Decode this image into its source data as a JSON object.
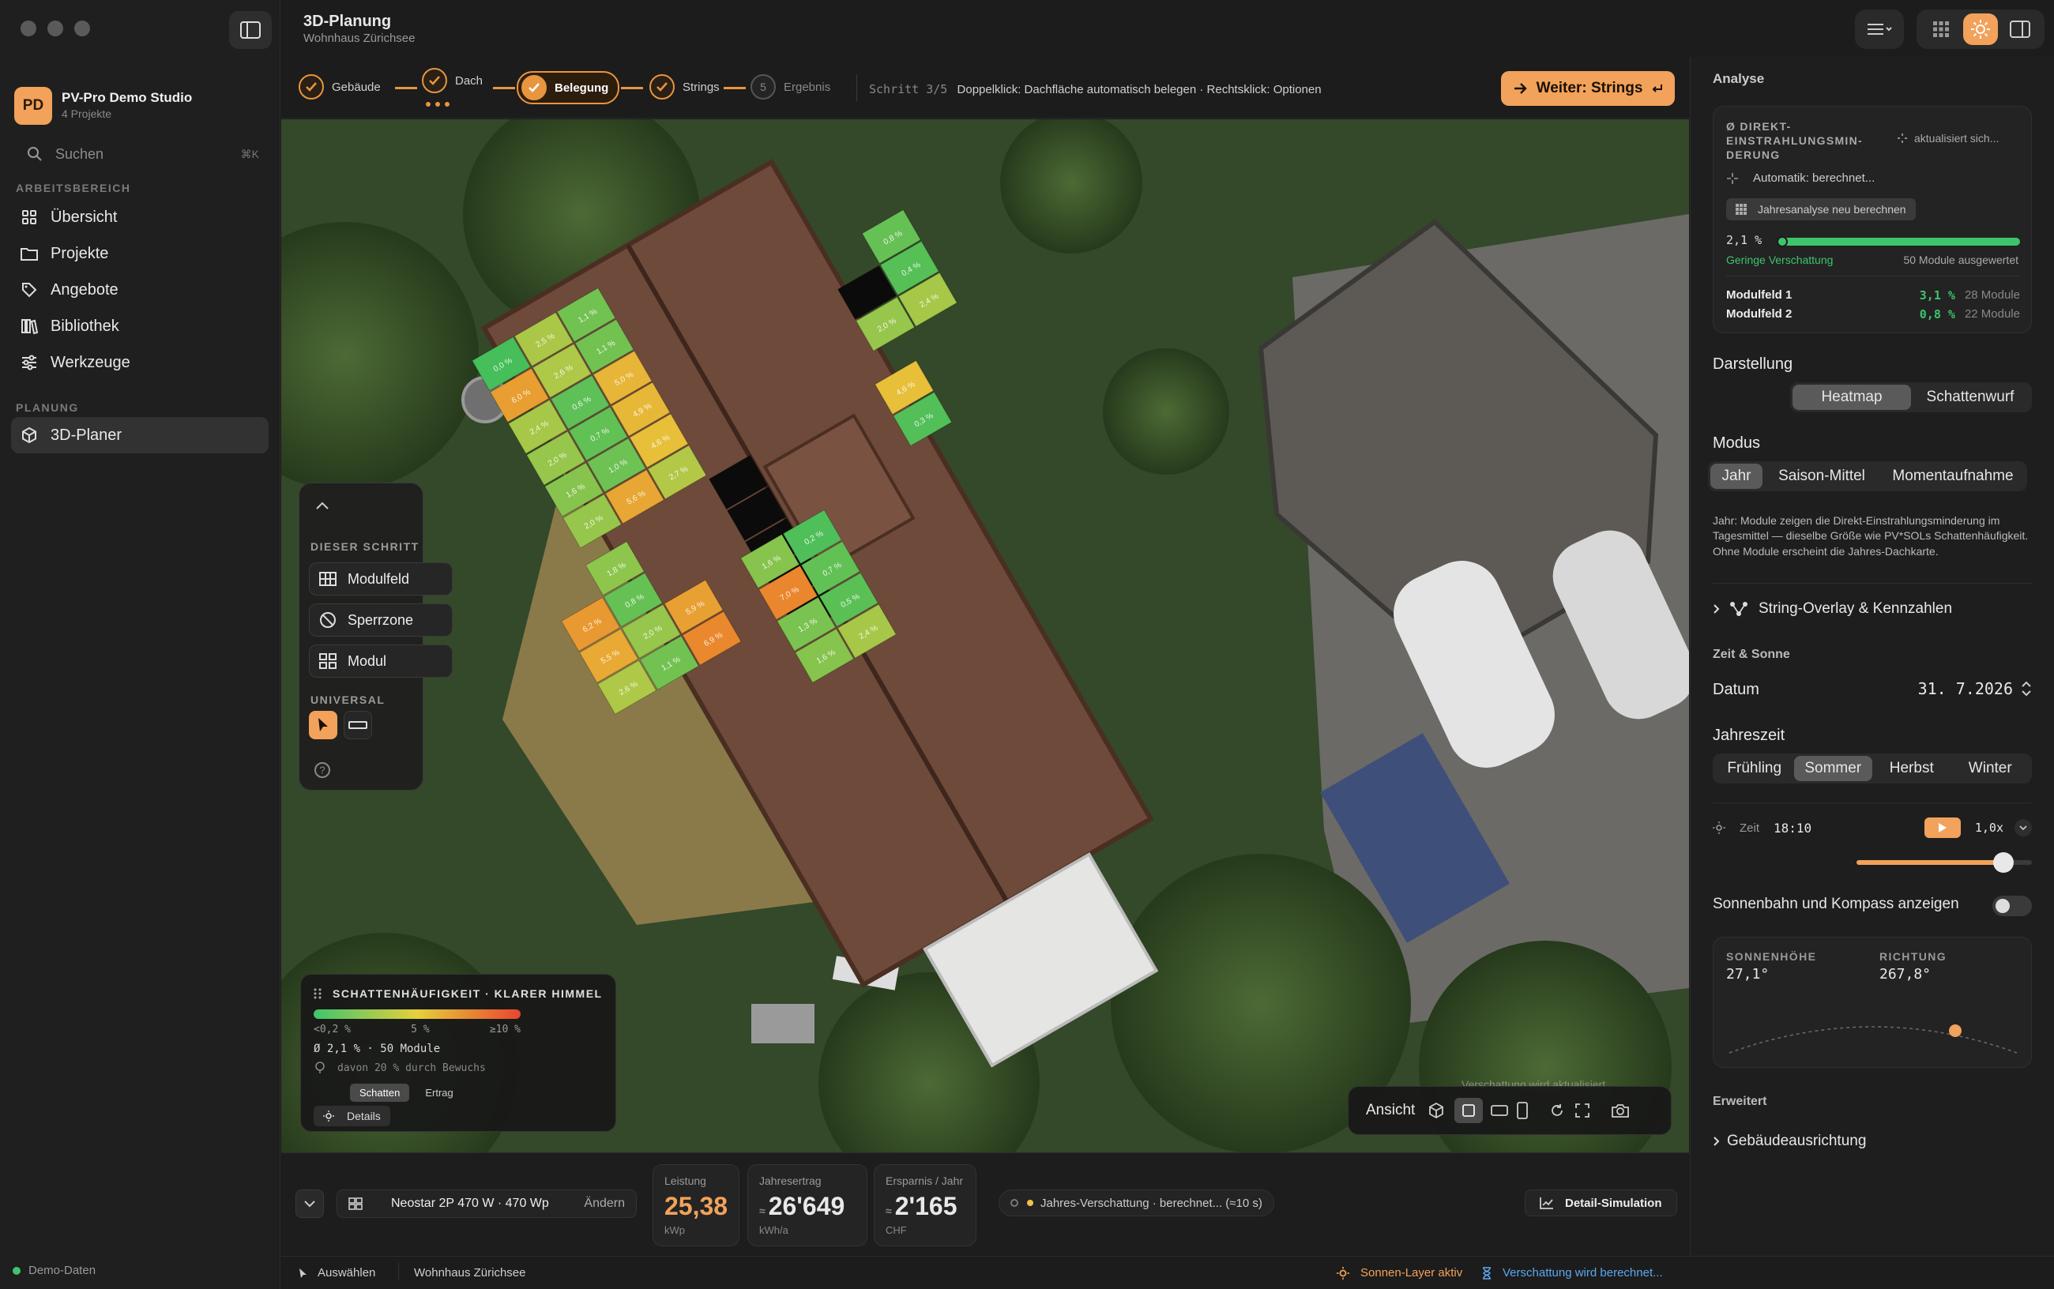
{
  "sidebar": {
    "workspace_initials": "PD",
    "workspace_name": "PV-Pro Demo Studio",
    "workspace_sub": "4 Projekte",
    "search_placeholder": "Suchen",
    "search_shortcut": "⌘K",
    "section_work": "ARBEITSBEREICH",
    "items_work": [
      {
        "label": "Übersicht",
        "icon": "grid-icon"
      },
      {
        "label": "Projekte",
        "icon": "folder-icon"
      },
      {
        "label": "Angebote",
        "icon": "tag-icon"
      },
      {
        "label": "Bibliothek",
        "icon": "library-icon"
      },
      {
        "label": "Werkzeuge",
        "icon": "sliders-icon"
      }
    ],
    "section_plan": "PLANUNG",
    "items_plan": [
      {
        "label": "3D-Planer",
        "icon": "cube-icon"
      }
    ],
    "footer": "Demo-Daten"
  },
  "header": {
    "title": "3D-Planung",
    "subtitle": "Wohnhaus Zürichsee"
  },
  "stepper": {
    "steps": [
      {
        "label": "Gebäude",
        "state": "done"
      },
      {
        "label": "Dach",
        "state": "done"
      },
      {
        "label": "Belegung",
        "state": "active"
      },
      {
        "label": "Strings",
        "state": "done"
      },
      {
        "label": "Ergebnis",
        "state": "todo",
        "num": "5"
      }
    ],
    "hint_step": "Schritt 3/5",
    "hint_text": "Doppelklick: Dachfläche automatisch belegen · Rechtsklick: Optionen",
    "next_label": "Weiter: Strings"
  },
  "tools": {
    "section_step": "DIESER SCHRITT",
    "items": [
      "Modulfeld",
      "Sperrzone",
      "Modul"
    ],
    "section_universal": "UNIVERSAL"
  },
  "heat_cells": {
    "left_field": [
      "0,0 %",
      "2,5 %",
      "1,1 %",
      "6,0 %",
      "2,6 %",
      "1,1 %",
      "2,4 %",
      "0,6 %",
      "5,0 %",
      "2,0 %",
      "0,7 %",
      "4,9 %",
      "1,6 %",
      "1,0 %",
      "4,6 %",
      "2,0 %",
      "5,6 %",
      "2,7 %"
    ],
    "top_field": [
      "0,8 %",
      "0,4 %",
      "2,0 %",
      "2,4 %",
      "4,6 %",
      "0,3 %"
    ],
    "lower_left": [
      "1,8 %",
      "6,2 %",
      "0,8 %",
      "5,5 %",
      "2,0 %",
      "5,9 %",
      "2,6 %",
      "1,1 %",
      "6,9 %",
      "2,8 %"
    ],
    "right_field": [
      "1,6 %",
      "0,2 %",
      "7,0 %",
      "0,7 %",
      "1,3 %",
      "0,5 %",
      "1,6 %",
      "2,4 %"
    ]
  },
  "legend": {
    "title": "SCHATTENHÄUFIGKEIT · KLARER HIMMEL",
    "ticks": [
      "<0,2 %",
      "5 %",
      "≥10 %"
    ],
    "avg": "Ø 2,1 % · 50 Module",
    "vegetation": "davon 20 % durch Bewuchs",
    "tab_shadow": "Schatten",
    "tab_yield": "Ertrag",
    "details": "Details"
  },
  "view": {
    "label": "Ansicht",
    "recalc_note": "Verschattung wird aktualisiert"
  },
  "bottombar": {
    "module": "Neostar 2P 470 W · 470 Wp",
    "change": "Ändern",
    "kpis": [
      {
        "label": "Leistung",
        "value": "25,38",
        "unit": "kWp",
        "accent": true
      },
      {
        "label": "Jahresertrag",
        "value": "26'649",
        "unit": "kWh/a",
        "approx": "≈"
      },
      {
        "label": "Ersparnis / Jahr",
        "value": "2'165",
        "unit": "CHF",
        "approx": "≈"
      }
    ],
    "shading_chip": "Jahres-Verschattung · berechnet... (≈10 s)",
    "detail_sim": "Detail-Simulation"
  },
  "statusbar": {
    "mode": "Auswählen",
    "project": "Wohnhaus Zürichsee",
    "sun_layer": "Sonnen-Layer aktiv",
    "shading": "Verschattung wird berechnet..."
  },
  "rpanel": {
    "analyse": "Analyse",
    "metric_title": "Ø DIREKT-EINSTRAHLUNGSMIN-DERUNG",
    "updating": "aktualisiert sich...",
    "auto": "Automatik: berechnet...",
    "recalc": "Jahresanalyse neu berechnen",
    "value": "2,1 %",
    "progress": 0.021,
    "low_shading": "Geringe Verschattung",
    "evaluated": "50 Module ausgewertet",
    "fields": [
      {
        "name": "Modulfeld 1",
        "val": "3,1 %",
        "mods": "28 Module"
      },
      {
        "name": "Modulfeld 2",
        "val": "0,8 %",
        "mods": "22 Module"
      }
    ],
    "darstellung": "Darstellung",
    "darst_opts": [
      "Heatmap",
      "Schattenwurf"
    ],
    "modus": "Modus",
    "modus_opts": [
      "Jahr",
      "Saison-Mittel",
      "Momentaufnahme"
    ],
    "modus_desc": "Jahr: Module zeigen die Direkt-Einstrahlungsminderung im Tagesmittel — dieselbe Größe wie PV*SOLs Schattenhäufigkeit. Ohne Module erscheint die Jahres-Dachkarte.",
    "string_overlay": "String-Overlay & Kennzahlen",
    "zeit_sonne": "Zeit & Sonne",
    "datum_label": "Datum",
    "datum_value": "31. 7.2026",
    "jahreszeit": "Jahreszeit",
    "seasons": [
      "Frühling",
      "Sommer",
      "Herbst",
      "Winter"
    ],
    "zeit_label": "Zeit",
    "zeit_value": "18:10",
    "speed": "1,0x",
    "time_slider": 0.84,
    "sun_path_label": "Sonnenbahn und Kompass anzeigen",
    "sonnenhoehe_label": "SONNENHÖHE",
    "sonnenhoehe": "27,1°",
    "richtung_label": "RICHTUNG",
    "richtung": "267,8°",
    "erweitert": "Erweitert",
    "gebaeude": "Gebäudeausrichtung"
  },
  "colors": {
    "accent": "#f2a25a",
    "green": "#3ec46d",
    "bg": "#1b1b1b"
  }
}
